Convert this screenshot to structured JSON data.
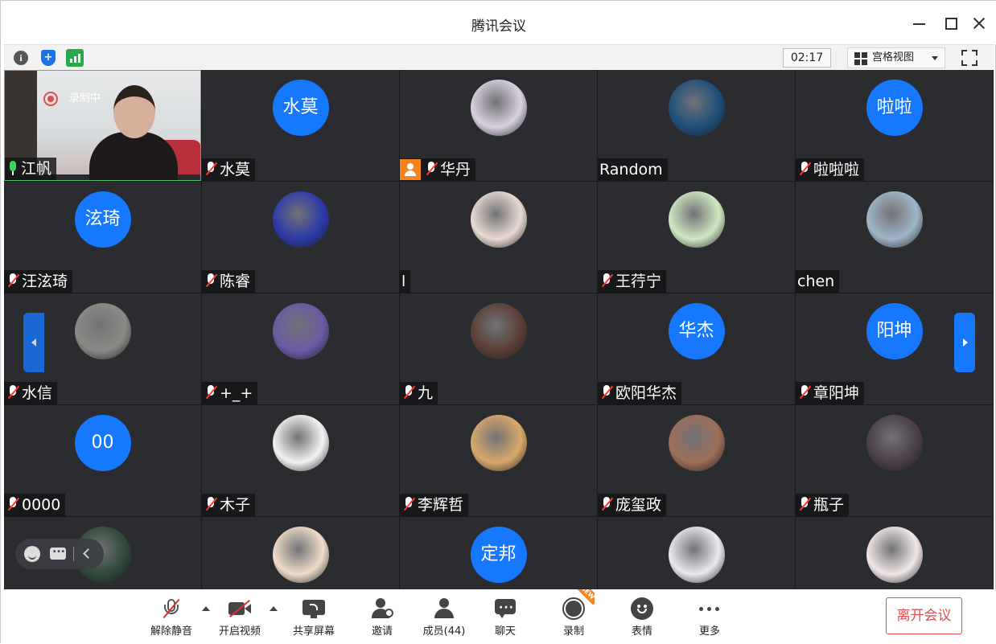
{
  "window": {
    "title": "腾讯会议"
  },
  "toolbar": {
    "timer": "02:17",
    "view_label": "宫格视图"
  },
  "self": {
    "name": "江帆",
    "recording_label": "录制中"
  },
  "participants": [
    {
      "name": "水莫",
      "avatar_text": "水莫",
      "mic": "off"
    },
    {
      "name": "华丹",
      "avatar_text": "",
      "mic": "off",
      "host": true,
      "avatar_color": "#d8d0df"
    },
    {
      "name": "Random",
      "avatar_text": "",
      "mic": "none",
      "avatar_color": "#1f4f7a"
    },
    {
      "name": "啦啦啦",
      "avatar_text": "啦啦",
      "mic": "off"
    },
    {
      "name": "汪泫琦",
      "avatar_text": "泫琦",
      "mic": "off"
    },
    {
      "name": "陈睿",
      "avatar_text": "",
      "mic": "off",
      "avatar_color": "#2b3aa8"
    },
    {
      "name": "l",
      "avatar_text": "",
      "mic": "none",
      "avatar_color": "#e8d9d2"
    },
    {
      "name": "王荇宁",
      "avatar_text": "",
      "mic": "off",
      "avatar_color": "#cfe8c0"
    },
    {
      "name": "chen",
      "avatar_text": "",
      "mic": "none",
      "avatar_color": "#9fb6c8"
    },
    {
      "name": "水信",
      "avatar_text": "",
      "mic": "off",
      "avatar_color": "#8c8a86"
    },
    {
      "name": "+_+",
      "avatar_text": "",
      "mic": "off",
      "avatar_color": "#6b5aa3"
    },
    {
      "name": "九",
      "avatar_text": "",
      "mic": "off",
      "avatar_color": "#5a3f35"
    },
    {
      "name": "欧阳华杰",
      "avatar_text": "华杰",
      "mic": "off"
    },
    {
      "name": "章阳坤",
      "avatar_text": "阳坤",
      "mic": "off"
    },
    {
      "name": "0000",
      "avatar_text": "00",
      "mic": "off"
    },
    {
      "name": "木子",
      "avatar_text": "",
      "mic": "off",
      "avatar_color": "#f2f2f2"
    },
    {
      "name": "李辉哲",
      "avatar_text": "",
      "mic": "off",
      "avatar_color": "#d9a86a"
    },
    {
      "name": "庞玺政",
      "avatar_text": "",
      "mic": "off",
      "avatar_color": "#9c6e58"
    },
    {
      "name": "瓶子",
      "avatar_text": "",
      "mic": "off",
      "avatar_color": "#4a3e4a"
    },
    {
      "name": "",
      "avatar_text": "",
      "mic": "none",
      "avatar_color": "#2f4a3a"
    },
    {
      "name": "",
      "avatar_text": "",
      "mic": "none",
      "avatar_color": "#efdcc8"
    },
    {
      "name": "",
      "avatar_text": "定邦",
      "mic": "none"
    },
    {
      "name": "",
      "avatar_text": "",
      "mic": "none",
      "avatar_color": "#e9e9ee"
    },
    {
      "name": "",
      "avatar_text": "",
      "mic": "none",
      "avatar_color": "#f0e6e6"
    }
  ],
  "bottombar": {
    "unmute_label": "解除静音",
    "video_label": "开启视频",
    "share_label": "共享屏幕",
    "invite_label": "邀请",
    "members_label": "成员(44)",
    "chat_label": "聊天",
    "record_label": "录制",
    "record_badge": "NEW",
    "reactions_label": "表情",
    "more_label": "更多",
    "leave_label": "离开会议"
  },
  "colors": {
    "accent": "#1677ff",
    "tile_bg": "#2b2c30",
    "leave": "#e24b4b",
    "host": "#f5841f"
  }
}
